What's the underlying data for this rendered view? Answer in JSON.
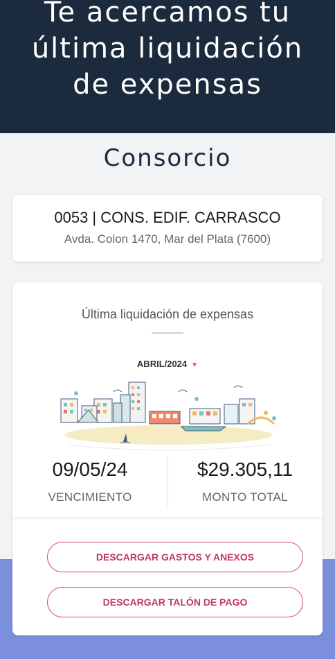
{
  "hero": {
    "line1": "Te acercamos tu",
    "line2": "última liquidación",
    "line3": "de expensas"
  },
  "section_title": "Consorcio",
  "consorcio": {
    "name": "0053 | CONS. EDIF. CARRASCO",
    "address": "Avda. Colon 1470, Mar del Plata (7600)"
  },
  "liquidacion": {
    "heading": "Última liquidación de expensas",
    "period": "ABRIL/2024",
    "due_date": "09/05/24",
    "due_label": "VENCIMIENTO",
    "amount": "$29.305,11",
    "amount_label": "MONTO TOTAL"
  },
  "buttons": {
    "gastos": "DESCARGAR GASTOS Y ANEXOS",
    "talon": "DESCARGAR TALÓN DE PAGO"
  },
  "colors": {
    "hero_bg": "#1b2a3c",
    "accent": "#c0385f",
    "band": "#7b8fdc"
  },
  "icons": {
    "period_caret": "caret-down-icon",
    "illustration": "city-skyline-illustration"
  }
}
